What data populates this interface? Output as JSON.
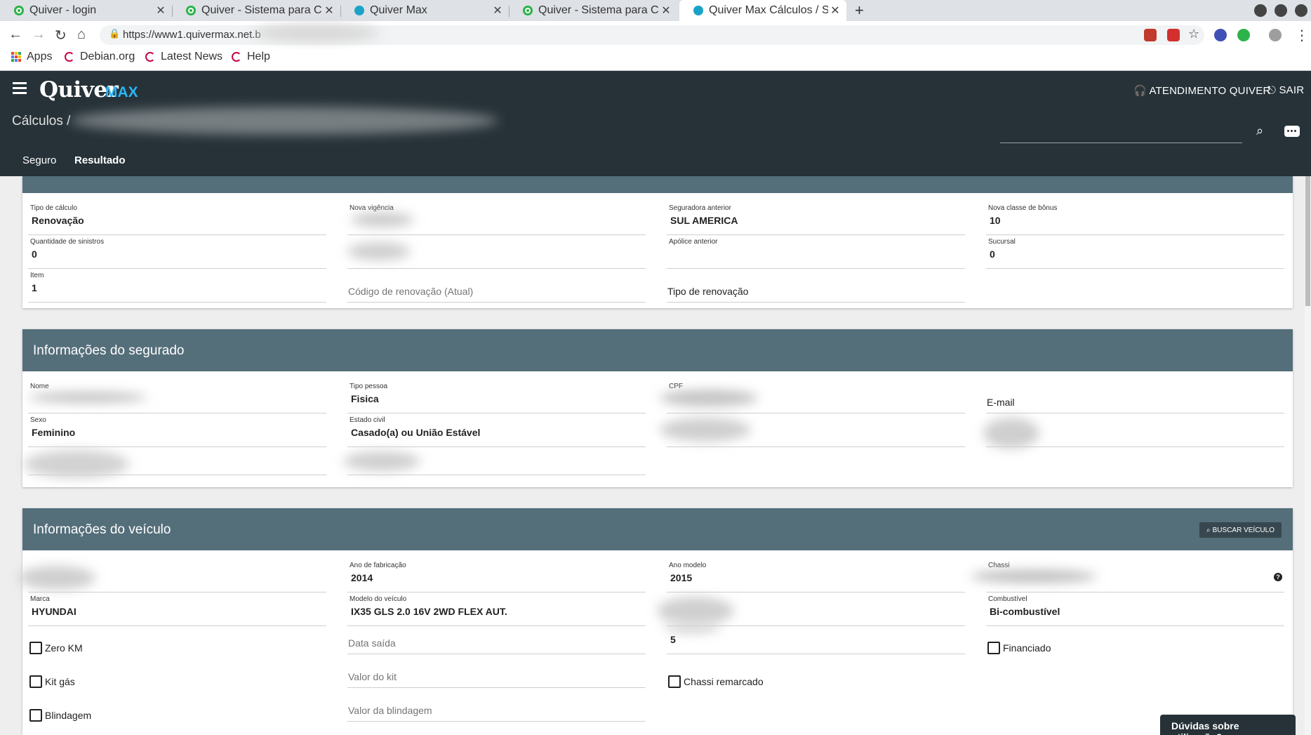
{
  "browser": {
    "tabs": [
      {
        "label": "Quiver - login",
        "favicon": "green-circle-icon"
      },
      {
        "label": "Quiver - Sistema para Cor",
        "favicon": "green-circle-icon"
      },
      {
        "label": "Quiver Max",
        "favicon": "quiver-icon"
      },
      {
        "label": "Quiver - Sistema para Cor",
        "favicon": "green-circle-icon"
      },
      {
        "label": "Quiver Max Cálculos / SIO",
        "favicon": "quiver-icon"
      }
    ],
    "url": "https://www1.quivermax.net.b",
    "bookmarks": [
      "Apps",
      "Debian.org",
      "Latest News",
      "Help"
    ]
  },
  "header": {
    "logo": "Quiver",
    "logo_suffix": "MAX",
    "atendimento": "ATENDIMENTO QUIVER",
    "sair": "SAIR",
    "breadcrumb": "Cálculos /",
    "subtabs": [
      "Seguro",
      "Resultado"
    ]
  },
  "seguro_section": {
    "tipo_calculo_label": "Tipo de cálculo",
    "tipo_calculo_value": "Renovação",
    "nova_vigencia_label": "Nova vigência",
    "seguradora_label": "Seguradora anterior",
    "seguradora_value": "SUL AMERICA",
    "nova_classe_label": "Nova classe de bônus",
    "nova_classe_value": "10",
    "qtd_sinistros_label": "Quantidade de sinistros",
    "qtd_sinistros_value": "0",
    "apolice_label": "Apólice anterior",
    "sucursal_label": "Sucursal",
    "sucursal_value": "0",
    "item_label": "Item",
    "item_value": "1",
    "codigo_renovacao_placeholder": "Código de renovação (Atual)",
    "tipo_renovacao_placeholder": "Tipo de renovação"
  },
  "segurado": {
    "title": "Informações do segurado",
    "nome_label": "Nome",
    "tipo_pessoa_label": "Tipo pessoa",
    "tipo_pessoa_value": "Fisica",
    "cpf_label": "CPF",
    "email_placeholder": "E-mail",
    "sexo_label": "Sexo",
    "sexo_value": "Feminino",
    "estado_civil_label": "Estado civil",
    "estado_civil_value": "Casado(a) ou União Estável"
  },
  "veiculo": {
    "title": "Informações do veículo",
    "buscar_button": "BUSCAR VEÍCULO",
    "ano_fab_label": "Ano de fabricação",
    "ano_fab_value": "2014",
    "ano_modelo_label": "Ano modelo",
    "ano_modelo_value": "2015",
    "chassi_label": "Chassi",
    "marca_label": "Marca",
    "marca_value": "HYUNDAI",
    "modelo_label": "Modelo do veículo",
    "modelo_value": "IX35 GLS 2.0 16V 2WD FLEX AUT.",
    "combustivel_label": "Combustível",
    "combustivel_value": "Bi-combustível",
    "lotacao_value": "5",
    "zero_km": "Zero KM",
    "data_saida_placeholder": "Data saída",
    "financiado": "Financiado",
    "kit_gas": "Kit gás",
    "valor_kit_placeholder": "Valor do kit",
    "chassi_remarcado": "Chassi remarcado",
    "blindagem": "Blindagem",
    "valor_blindagem_placeholder": "Valor da blindagem"
  },
  "help_widget": "Dúvidas sobre utilização?"
}
